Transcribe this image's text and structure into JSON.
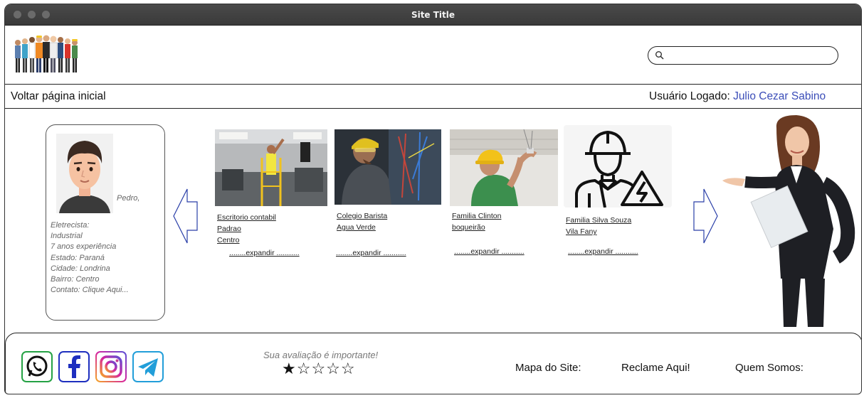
{
  "window": {
    "title": "Site Title"
  },
  "header": {
    "search": {
      "placeholder": "",
      "icon": "search-icon"
    }
  },
  "nav": {
    "back_label": "Voltar página inicial",
    "user_label": "Usuário Logado:",
    "user_name": "Julio Cezar Sabino"
  },
  "profile": {
    "name": "Pedro,",
    "lines": [
      "Eletrecista:",
      "Industrial",
      "7 anos experiência",
      "Estado: Paraná",
      "Cidade: Londrina",
      "Bairro: Centro",
      "Contato: Clique Aqui..."
    ]
  },
  "cards": [
    {
      "caption": [
        "Escritorio contabil",
        "Padrao",
        "Centro"
      ],
      "expand": "........expandir ..........."
    },
    {
      "caption": [
        "Colegio Barista",
        "Agua Verde"
      ],
      "expand": "........expandir ..........."
    },
    {
      "caption": [
        "Familia Clinton",
        "boqueirão"
      ],
      "expand": "........expandir ..........."
    },
    {
      "caption": [
        "Familia Silva Souza",
        "Vila Fany"
      ],
      "expand": "........expandir ..........."
    }
  ],
  "footer": {
    "rating_prompt": "Sua avaliação é importante!",
    "rating": {
      "value": 1,
      "max": 5,
      "filled": "★",
      "empty": "☆☆☆☆"
    },
    "links": {
      "sitemap": "Mapa do Site:",
      "complaint": "Reclame Aqui!",
      "about": "Quem Somos:"
    },
    "social_icons": [
      "whatsapp-icon",
      "facebook-icon",
      "instagram-icon",
      "telegram-icon"
    ],
    "colors": {
      "whatsapp": "#25a244",
      "facebook": "#1e2fbf",
      "instagram": "#c23f96",
      "telegram": "#229ed9"
    }
  },
  "colors": {
    "user_name": "#3b4db8",
    "arrow": "#2a3fa8"
  }
}
